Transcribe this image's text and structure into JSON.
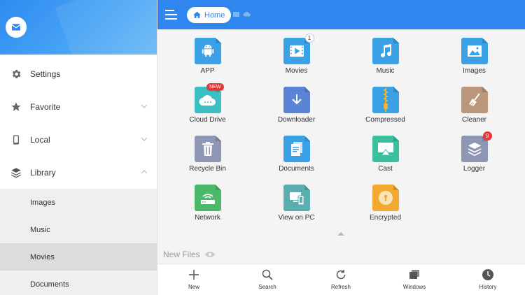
{
  "sidebar": {
    "items": [
      {
        "label": "Settings"
      },
      {
        "label": "Favorite"
      },
      {
        "label": "Local"
      },
      {
        "label": "Library"
      }
    ],
    "library_sub": [
      {
        "label": "Images"
      },
      {
        "label": "Music"
      },
      {
        "label": "Movies"
      },
      {
        "label": "Documents"
      }
    ]
  },
  "topbar": {
    "breadcrumb": "Home"
  },
  "grid": {
    "items": [
      {
        "label": "APP",
        "icon": "android-icon",
        "color": "#3aa1e6"
      },
      {
        "label": "Movies",
        "icon": "play-icon",
        "color": "#3aa1e6",
        "badge": "1"
      },
      {
        "label": "Music",
        "icon": "music-note-icon",
        "color": "#3aa1e6"
      },
      {
        "label": "Images",
        "icon": "image-icon",
        "color": "#3aa1e6"
      },
      {
        "label": "Cloud Drive",
        "icon": "cloud-icon",
        "color": "#3cbfc2",
        "badge": "NEW"
      },
      {
        "label": "Downloader",
        "icon": "download-icon",
        "color": "#5b83d6"
      },
      {
        "label": "Compressed",
        "icon": "zipper-icon",
        "color": "#3aa1e6"
      },
      {
        "label": "Cleaner",
        "icon": "broom-icon",
        "color": "#bc967a"
      },
      {
        "label": "Recycle Bin",
        "icon": "trash-icon",
        "color": "#8e96b3"
      },
      {
        "label": "Documents",
        "icon": "document-icon",
        "color": "#3aa1e6"
      },
      {
        "label": "Cast",
        "icon": "cast-icon",
        "color": "#3cbf9c"
      },
      {
        "label": "Logger",
        "icon": "layers-icon",
        "color": "#8e96b3",
        "badge": "9"
      },
      {
        "label": "Network",
        "icon": "router-icon",
        "color": "#4cb86a"
      },
      {
        "label": "View on PC",
        "icon": "monitor-phone-icon",
        "color": "#5aaeb0"
      },
      {
        "label": "Encrypted",
        "icon": "lock-icon",
        "color": "#f1a930"
      }
    ]
  },
  "new_files": {
    "label": "New Files"
  },
  "bottom": {
    "new": "New",
    "search": "Search",
    "refresh": "Refresh",
    "windows": "Windows",
    "history": "History"
  },
  "colors": {
    "accent": "#2f86ee",
    "sidebar_active": "#dcdcdc"
  }
}
